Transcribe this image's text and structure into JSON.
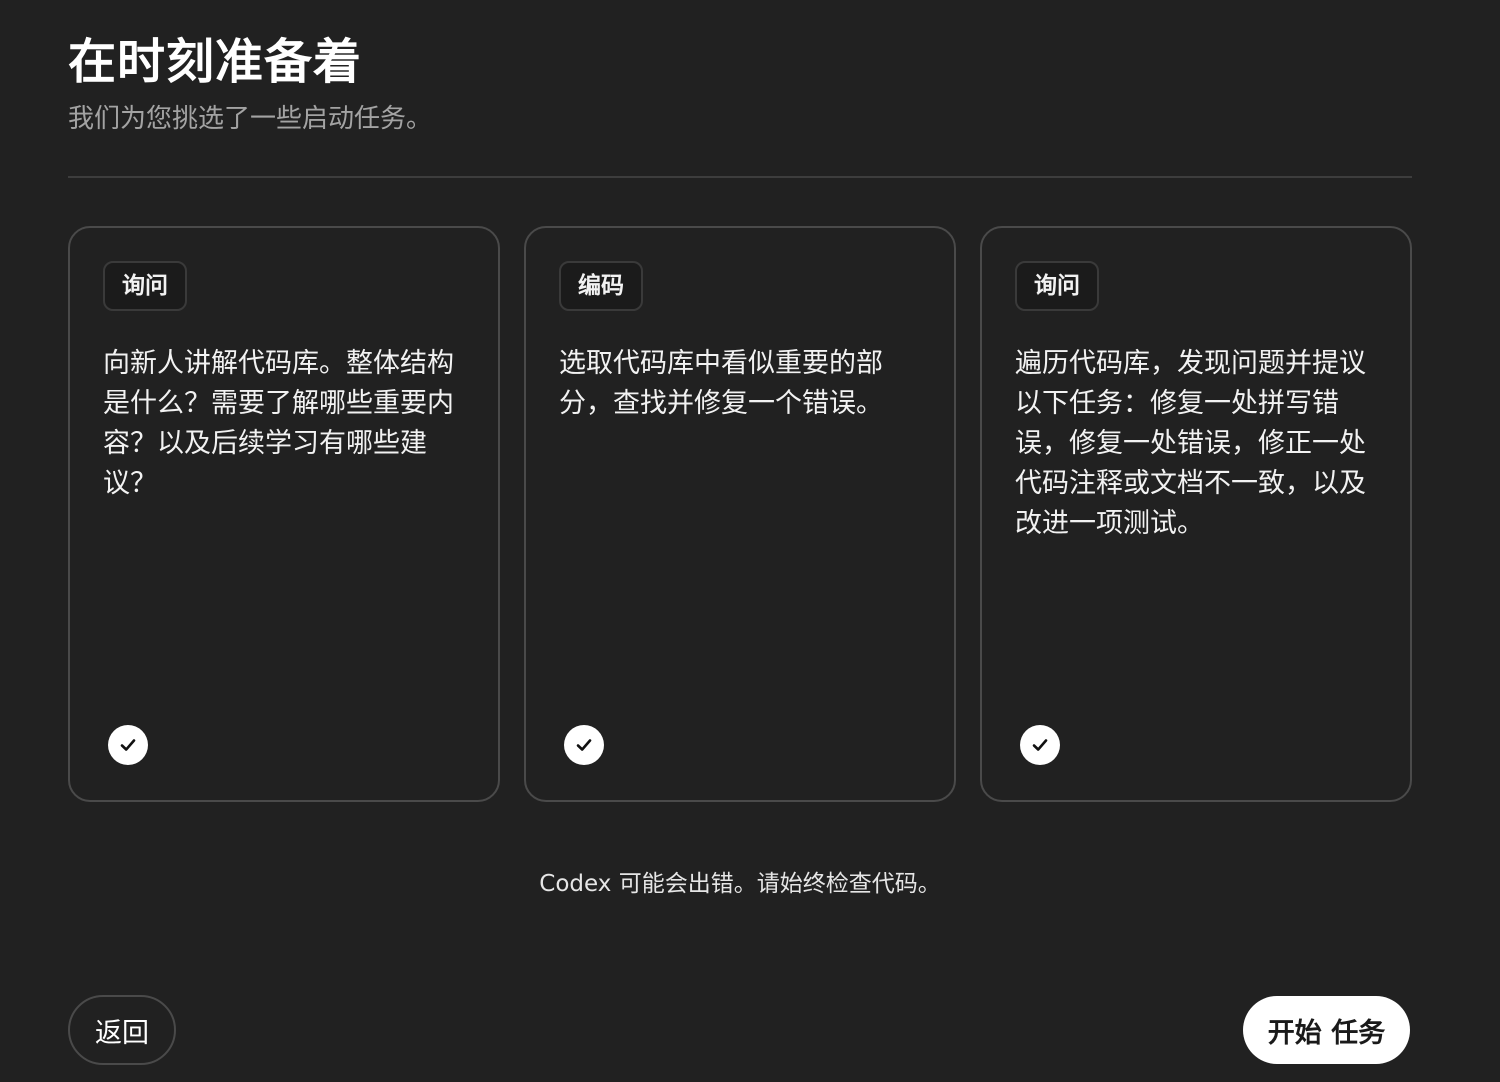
{
  "header": {
    "title": "在时刻准备着",
    "subtitle": "我们为您挑选了一些启动任务。"
  },
  "cards": [
    {
      "tag": "询问",
      "text": "向新人讲解代码库。整体结构是什么？需要了解哪些重要内容？以及后续学习有哪些建议？",
      "selected": true,
      "icon": "check-circle-icon"
    },
    {
      "tag": "编码",
      "text": "选取代码库中看似重要的部分，查找并修复一个错误。",
      "selected": true,
      "icon": "check-circle-icon"
    },
    {
      "tag": "询问",
      "text": "遍历代码库，发现问题并提议以下任务：修复一处拼写错误，修复一处错误，修正一处代码注释或文档不一致，以及改进一项测试。",
      "selected": true,
      "icon": "check-circle-icon"
    }
  ],
  "footer": {
    "disclaimer": "Codex 可能会出错。请始终检查代码。",
    "back_label": "返回",
    "start_label": "开始 任务"
  },
  "colors": {
    "background": "#212121",
    "card_border": "#4a4a4a",
    "primary_button": "#ffffff"
  }
}
